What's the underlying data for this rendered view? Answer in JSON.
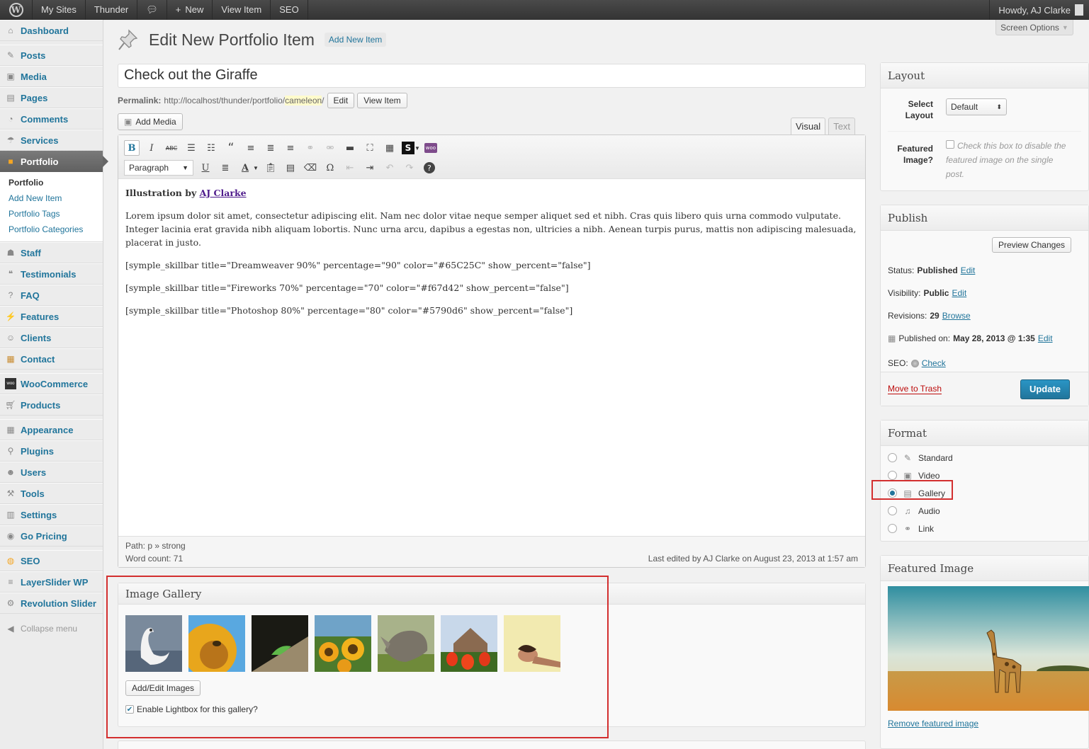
{
  "adminbar": {
    "my_sites": "My Sites",
    "site_name": "Thunder",
    "new": "New",
    "view_item": "View Item",
    "seo": "SEO",
    "howdy": "Howdy, AJ Clarke"
  },
  "sidebar": {
    "items": [
      {
        "label": "Dashboard",
        "icon": "dashboard-icon"
      },
      {
        "label": "Posts",
        "icon": "pin-icon"
      },
      {
        "label": "Media",
        "icon": "media-icon"
      },
      {
        "label": "Pages",
        "icon": "pages-icon"
      },
      {
        "label": "Comments",
        "icon": "comments-icon"
      },
      {
        "label": "Services",
        "icon": "services-icon"
      },
      {
        "label": "Portfolio",
        "icon": "portfolio-icon"
      },
      {
        "label": "Staff",
        "icon": "staff-icon"
      },
      {
        "label": "Testimonials",
        "icon": "testimonials-icon"
      },
      {
        "label": "FAQ",
        "icon": "faq-icon"
      },
      {
        "label": "Features",
        "icon": "features-icon"
      },
      {
        "label": "Clients",
        "icon": "clients-icon"
      },
      {
        "label": "Contact",
        "icon": "contact-icon"
      },
      {
        "label": "WooCommerce",
        "icon": "woocommerce-icon"
      },
      {
        "label": "Products",
        "icon": "products-icon"
      },
      {
        "label": "Appearance",
        "icon": "appearance-icon"
      },
      {
        "label": "Plugins",
        "icon": "plugins-icon"
      },
      {
        "label": "Users",
        "icon": "users-icon"
      },
      {
        "label": "Tools",
        "icon": "tools-icon"
      },
      {
        "label": "Settings",
        "icon": "settings-icon"
      },
      {
        "label": "Go Pricing",
        "icon": "go-pricing-icon"
      },
      {
        "label": "SEO",
        "icon": "seo-icon"
      },
      {
        "label": "LayerSlider WP",
        "icon": "layerslider-icon"
      },
      {
        "label": "Revolution Slider",
        "icon": "revolution-slider-icon"
      }
    ],
    "submenu": [
      "Portfolio",
      "Add New Item",
      "Portfolio Tags",
      "Portfolio Categories"
    ],
    "collapse": "Collapse menu"
  },
  "header": {
    "title": "Edit New Portfolio Item",
    "add_new": "Add New Item",
    "screen_options": "Screen Options"
  },
  "post": {
    "title": "Check out the Giraffe",
    "permalink_label": "Permalink:",
    "permalink_base": "http://localhost/thunder/portfolio/",
    "permalink_slug": "cameleon",
    "permalink_end": "/",
    "edit_btn": "Edit",
    "view_btn": "View Item"
  },
  "editor": {
    "add_media": "Add Media",
    "tab_visual": "Visual",
    "tab_text": "Text",
    "format_select": "Paragraph",
    "illustration_prefix": "Illustration by ",
    "illustration_author": "AJ Clarke",
    "paragraph": "Lorem ipsum dolor sit amet, consectetur adipiscing elit. Nam nec dolor vitae neque semper aliquet sed et nibh. Cras quis libero quis urna commodo vulputate. Integer lacinia erat gravida nibh aliquam lobortis. Nunc urna arcu, dapibus a egestas non, ultricies a nibh. Aenean turpis purus, mattis non adipiscing malesuada, placerat in justo.",
    "shortcodes": [
      "[symple_skillbar title=\"Dreamweaver 90%\" percentage=\"90\" color=\"#65C25C\" show_percent=\"false\"]",
      "[symple_skillbar title=\"Fireworks 70%\" percentage=\"70\" color=\"#f67d42\" show_percent=\"false\"]",
      "[symple_skillbar title=\"Photoshop  80%\" percentage=\"80\" color=\"#5790d6\" show_percent=\"false\"]"
    ],
    "path": "Path: p » strong",
    "word_count": "Word count: 71",
    "last_edited": "Last edited by AJ Clarke on August 23, 2013 at 1:57 am"
  },
  "gallery": {
    "title": "Image Gallery",
    "thumbnails": [
      "swan",
      "sunflower-bee",
      "lizard",
      "sunflowers",
      "rhino",
      "tulips-house",
      "woman-portrait"
    ],
    "add_edit_btn": "Add/Edit Images",
    "lightbox_label": "Enable Lightbox for this gallery?",
    "lightbox_checked": true
  },
  "layout_box": {
    "title": "Layout",
    "select_label": "Select Layout",
    "select_value": "Default",
    "featured_label": "Featured Image?",
    "featured_text": "Check this box to disable the featured image on the single post."
  },
  "publish_box": {
    "title": "Publish",
    "preview": "Preview Changes",
    "status_label": "Status:",
    "status_value": "Published",
    "visibility_label": "Visibility:",
    "visibility_value": "Public",
    "revisions_label": "Revisions:",
    "revisions_value": "29",
    "browse": "Browse",
    "published_label": "Published on:",
    "published_value": "May 28, 2013 @ 1:35",
    "seo_label": "SEO:",
    "seo_check": "Check",
    "edit": "Edit",
    "trash": "Move to Trash",
    "update": "Update"
  },
  "format_box": {
    "title": "Format",
    "options": [
      {
        "label": "Standard",
        "icon": "pin-icon",
        "selected": false
      },
      {
        "label": "Video",
        "icon": "video-icon",
        "selected": false
      },
      {
        "label": "Gallery",
        "icon": "gallery-icon",
        "selected": true
      },
      {
        "label": "Audio",
        "icon": "audio-icon",
        "selected": false
      },
      {
        "label": "Link",
        "icon": "link-icon",
        "selected": false
      }
    ]
  },
  "featured_box": {
    "title": "Featured Image",
    "image": "giraffe",
    "remove": "Remove featured image"
  },
  "colors": {
    "link": "#21759b",
    "highlight": "#d32f2f",
    "update": "#21759b",
    "trash": "#bc0b0b"
  }
}
